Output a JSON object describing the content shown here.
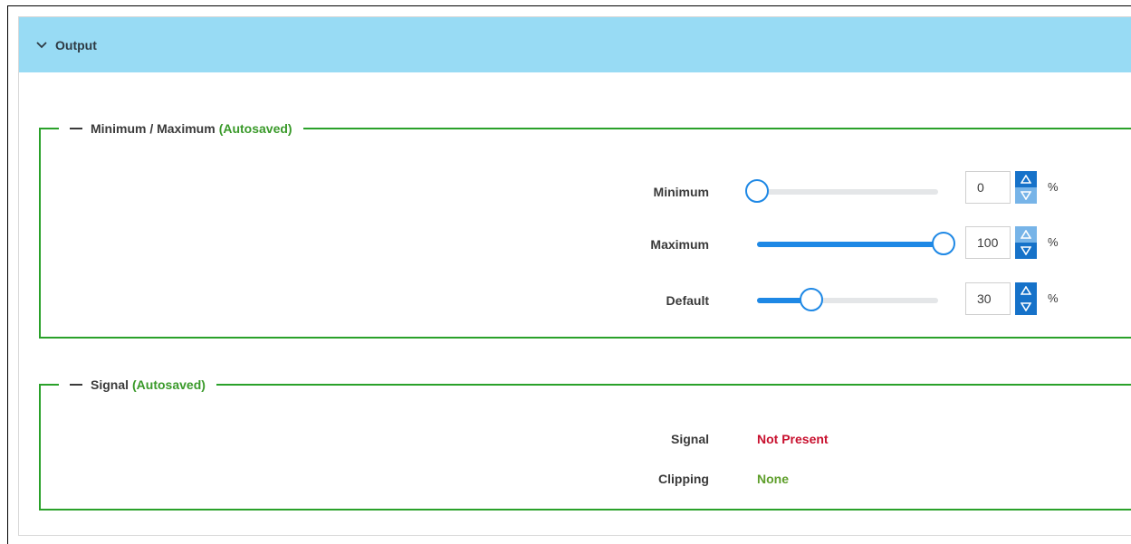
{
  "header": {
    "title": "Output",
    "chevron_icon": "chevron-down-icon"
  },
  "min_max": {
    "legend_title": "Minimum / Maximum",
    "legend_status": "(Autosaved)",
    "rows": [
      {
        "label": "Minimum",
        "value": "0",
        "unit": "%",
        "level": 0
      },
      {
        "label": "Maximum",
        "value": "100",
        "unit": "%",
        "level": 100
      },
      {
        "label": "Default",
        "value": "30",
        "unit": "%",
        "level": 30
      }
    ]
  },
  "signal": {
    "legend_title": "Signal",
    "legend_status": "(Autosaved)",
    "rows": [
      {
        "label": "Signal",
        "value": "Not Present",
        "color": "#c8102e"
      },
      {
        "label": "Clipping",
        "value": "None",
        "color": "#5e9e2a"
      }
    ]
  },
  "colors": {
    "header_bg": "#98dbf4",
    "group_border": "#2aa12a",
    "accent": "#1e88e5"
  }
}
